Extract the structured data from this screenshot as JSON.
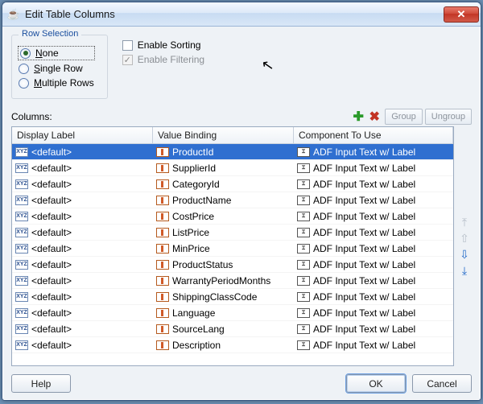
{
  "window": {
    "title": "Edit Table Columns"
  },
  "row_selection": {
    "legend": "Row Selection",
    "options": [
      {
        "label": "None",
        "checked": true
      },
      {
        "label": "Single Row",
        "checked": false
      },
      {
        "label": "Multiple Rows",
        "checked": false
      }
    ]
  },
  "options": {
    "enable_sorting": {
      "label": "Enable Sorting",
      "checked": false
    },
    "enable_filtering": {
      "label": "Enable Filtering",
      "checked": true,
      "disabled": true
    }
  },
  "columns_label": "Columns:",
  "toolbar": {
    "add_tip": "Add",
    "del_tip": "Delete",
    "group": "Group",
    "ungroup": "Ungroup"
  },
  "table": {
    "headers": {
      "display": "Display Label",
      "binding": "Value Binding",
      "component": "Component To Use"
    },
    "rows": [
      {
        "display": "<default>",
        "binding": "ProductId",
        "component": "ADF Input Text w/ Label",
        "selected": true
      },
      {
        "display": "<default>",
        "binding": "SupplierId",
        "component": "ADF Input Text w/ Label"
      },
      {
        "display": "<default>",
        "binding": "CategoryId",
        "component": "ADF Input Text w/ Label"
      },
      {
        "display": "<default>",
        "binding": "ProductName",
        "component": "ADF Input Text w/ Label"
      },
      {
        "display": "<default>",
        "binding": "CostPrice",
        "component": "ADF Input Text w/ Label"
      },
      {
        "display": "<default>",
        "binding": "ListPrice",
        "component": "ADF Input Text w/ Label"
      },
      {
        "display": "<default>",
        "binding": "MinPrice",
        "component": "ADF Input Text w/ Label"
      },
      {
        "display": "<default>",
        "binding": "ProductStatus",
        "component": "ADF Input Text w/ Label"
      },
      {
        "display": "<default>",
        "binding": "WarrantyPeriodMonths",
        "component": "ADF Input Text w/ Label"
      },
      {
        "display": "<default>",
        "binding": "ShippingClassCode",
        "component": "ADF Input Text w/ Label"
      },
      {
        "display": "<default>",
        "binding": "Language",
        "component": "ADF Input Text w/ Label"
      },
      {
        "display": "<default>",
        "binding": "SourceLang",
        "component": "ADF Input Text w/ Label"
      },
      {
        "display": "<default>",
        "binding": "Description",
        "component": "ADF Input Text w/ Label"
      }
    ]
  },
  "footer": {
    "help": "Help",
    "ok": "OK",
    "cancel": "Cancel"
  }
}
